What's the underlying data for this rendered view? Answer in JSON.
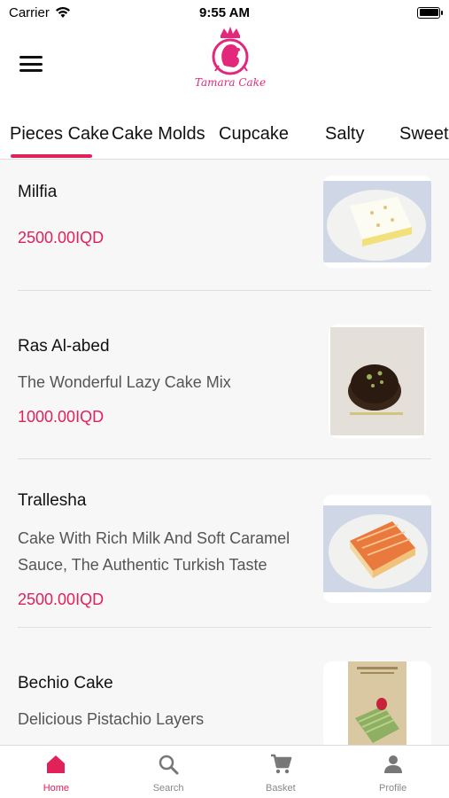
{
  "status_bar": {
    "carrier": "Carrier",
    "time": "9:55 AM"
  },
  "header": {
    "logo_text": "Tamara Cake"
  },
  "tabs": [
    {
      "label": "Pieces Cake",
      "active": true
    },
    {
      "label": "Cake Molds",
      "active": false
    },
    {
      "label": "Cupcake",
      "active": false
    },
    {
      "label": "Salty",
      "active": false
    },
    {
      "label": "Sweet C",
      "active": false
    }
  ],
  "products": [
    {
      "name": "Milfia",
      "description": "",
      "price": "2500.00IQD",
      "image": "square cake slice with white cream and nuts on plate"
    },
    {
      "name": "Ras Al-abed",
      "description": "The Wonderful Lazy Cake Mix",
      "price": "1000.00IQD",
      "image": "chocolate dome dessert with pistachio"
    },
    {
      "name": "Trallesha",
      "description": "Cake With Rich Milk And Soft Caramel Sauce, The Authentic Turkish Taste",
      "price": "2500.00IQD",
      "image": "caramel trilece cake on plate"
    },
    {
      "name": "Bechio Cake",
      "description": "Delicious Pistachio Layers",
      "price": "",
      "image": "pistachio layered cake slice with strawberry"
    }
  ],
  "bottom_nav": [
    {
      "label": "Home",
      "icon": "home-icon",
      "active": true
    },
    {
      "label": "Search",
      "icon": "search-icon",
      "active": false
    },
    {
      "label": "Basket",
      "icon": "cart-icon",
      "active": false
    },
    {
      "label": "Profile",
      "icon": "person-icon",
      "active": false
    }
  ],
  "colors": {
    "accent": "#e0215a",
    "logo_pink": "#e3287c",
    "list_background": "#f7f7f7"
  }
}
